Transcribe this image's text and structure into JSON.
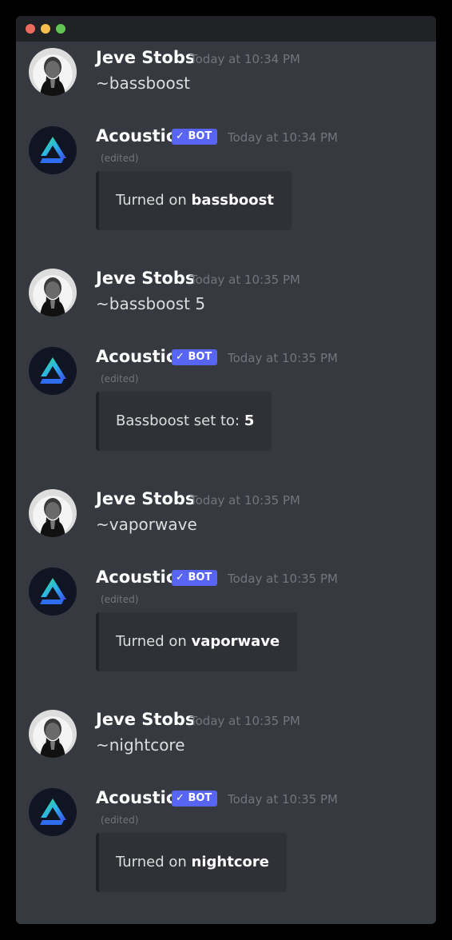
{
  "window": {
    "title_dots": [
      "close",
      "minimize",
      "maximize"
    ],
    "colors": {
      "close": "#ed6a5e",
      "minimize": "#f5bf4f",
      "maximize": "#61c454"
    }
  },
  "colors": {
    "background": "#36393f",
    "embed_bg": "#2f3136",
    "bot_badge": "#5865f2",
    "username": "#ffffff",
    "timestamp": "#72767d",
    "text": "#dcddde"
  },
  "messages": [
    {
      "author": "Jeve Stobs",
      "avatar": "man-portrait-avatar",
      "timestamp": "Today at 10:34 PM",
      "text": "~bassboost"
    },
    {
      "author": "Acoustic",
      "avatar": "acoustic-logo-avatar",
      "bot_badge": "BOT",
      "timestamp": "Today at 10:34 PM",
      "edited": "(edited)",
      "embed_prefix": "Turned on ",
      "embed_bold": "bassboost"
    },
    {
      "author": "Jeve Stobs",
      "avatar": "man-portrait-avatar",
      "timestamp": "Today at 10:35 PM",
      "text": "~bassboost 5"
    },
    {
      "author": "Acoustic",
      "avatar": "acoustic-logo-avatar",
      "bot_badge": "BOT",
      "timestamp": "Today at 10:35 PM",
      "edited": "(edited)",
      "embed_prefix": "Bassboost set to: ",
      "embed_bold": "5"
    },
    {
      "author": "Jeve Stobs",
      "avatar": "man-portrait-avatar",
      "timestamp": "Today at 10:35 PM",
      "text": "~vaporwave"
    },
    {
      "author": "Acoustic",
      "avatar": "acoustic-logo-avatar",
      "bot_badge": "BOT",
      "timestamp": "Today at 10:35 PM",
      "edited": "(edited)",
      "embed_prefix": "Turned on ",
      "embed_bold": "vaporwave"
    },
    {
      "author": "Jeve Stobs",
      "avatar": "man-portrait-avatar",
      "timestamp": "Today at 10:35 PM",
      "text": "~nightcore"
    },
    {
      "author": "Acoustic",
      "avatar": "acoustic-logo-avatar",
      "bot_badge": "BOT",
      "timestamp": "Today at 10:35 PM",
      "edited": "(edited)",
      "embed_prefix": "Turned on ",
      "embed_bold": "nightcore"
    }
  ]
}
